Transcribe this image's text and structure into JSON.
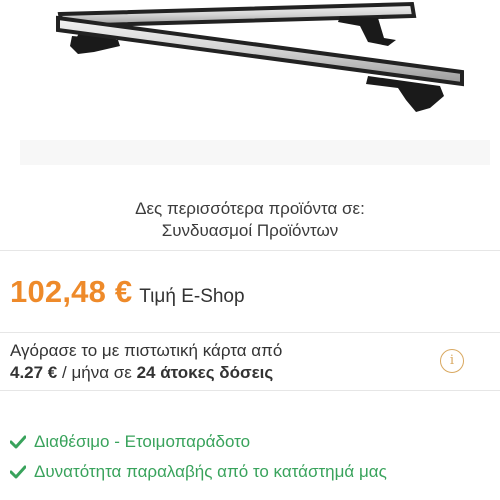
{
  "see_more": {
    "prefix": "Δες περισσότερα προϊόντα σε:",
    "link": "Συνδυασμοί Προϊόντων"
  },
  "price": {
    "value": "102,48 €",
    "label": "Τιμή E-Shop"
  },
  "credit": {
    "line1": "Αγόρασε το με πιστωτική κάρτα από",
    "amount": "4.27 €",
    "per_month": "/ μήνα σε",
    "installments": "24 άτοκες δόσεις"
  },
  "availability": [
    {
      "text": "Διαθέσιμο - Ετοιμοπαράδοτο",
      "icon": "check-icon"
    },
    {
      "text": "Δυνατότητα παραλαβής από το κατάστημά μας",
      "icon": "check-icon"
    }
  ],
  "colors": {
    "price": "#ee8a2a",
    "available": "#39a35c",
    "info": "#d9a860"
  }
}
